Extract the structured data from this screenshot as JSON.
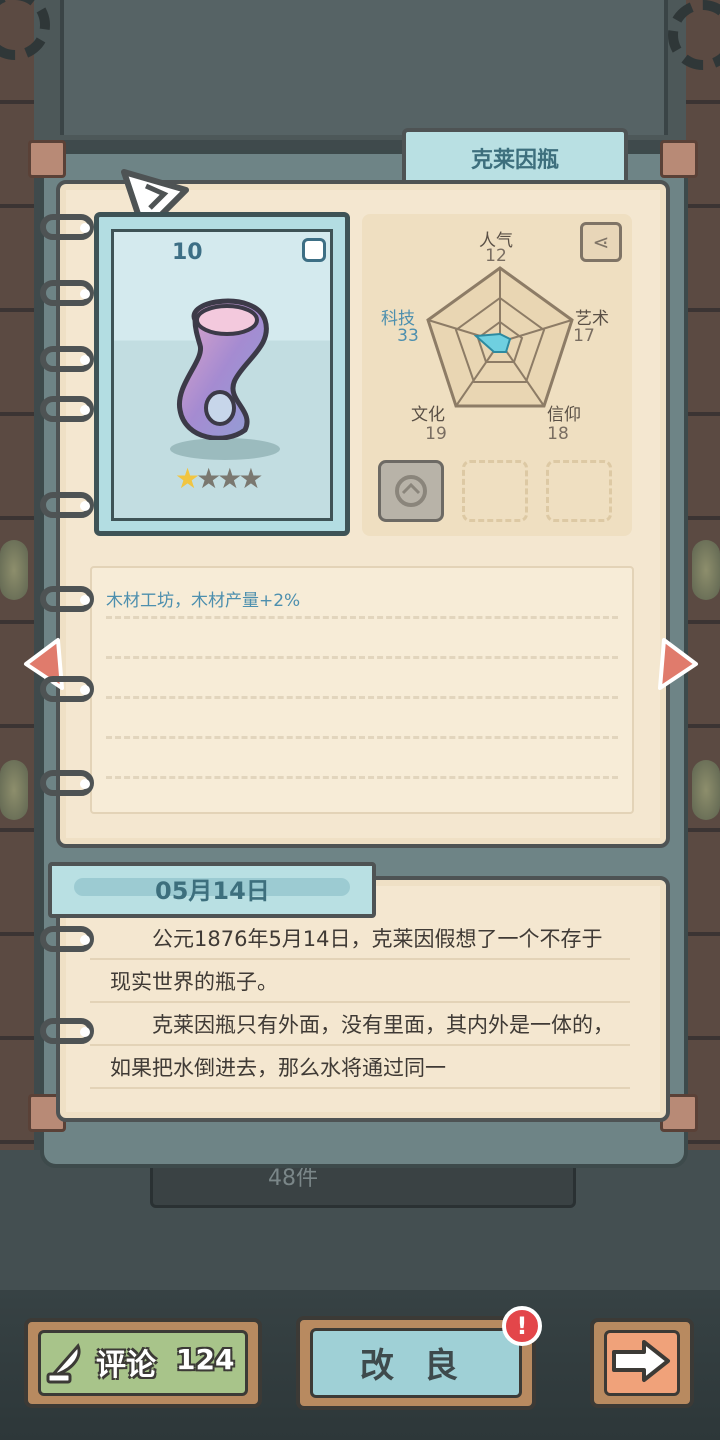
{
  "item": {
    "name": "克莱因瓶",
    "puzzle_pieces": "10",
    "stars_filled": 1,
    "stars_total": 4,
    "effect": "木材工坊，木材产量+2%"
  },
  "stats": {
    "popularity": {
      "label": "人气",
      "value": "12"
    },
    "art": {
      "label": "艺术",
      "value": "17"
    },
    "faith": {
      "label": "信仰",
      "value": "18"
    },
    "culture": {
      "label": "文化",
      "value": "19"
    },
    "technology": {
      "label": "科技",
      "value": "33"
    }
  },
  "diary": {
    "date": "05月14日",
    "paragraph1": "公元1876年5月14日，克莱因假想了一个不存于现实世界的瓶子。",
    "paragraph2": "克莱因瓶只有外面，没有里面，其内外是一体的，如果把水倒进去，那么水将通过同一"
  },
  "collection_count": "48件",
  "buttons": {
    "comment_label": "评论",
    "comment_count": "124",
    "improve_label": "改良",
    "improve_badge": "!"
  },
  "colors": {
    "accent_blue": "#4d8fae",
    "page": "#f4e7d0",
    "tab": "#b9e0e3",
    "badge": "#e3464a"
  },
  "icons": [
    "share-icon",
    "puzzle-icon",
    "quill-icon",
    "arrow-right-icon",
    "arrow-left-icon"
  ]
}
